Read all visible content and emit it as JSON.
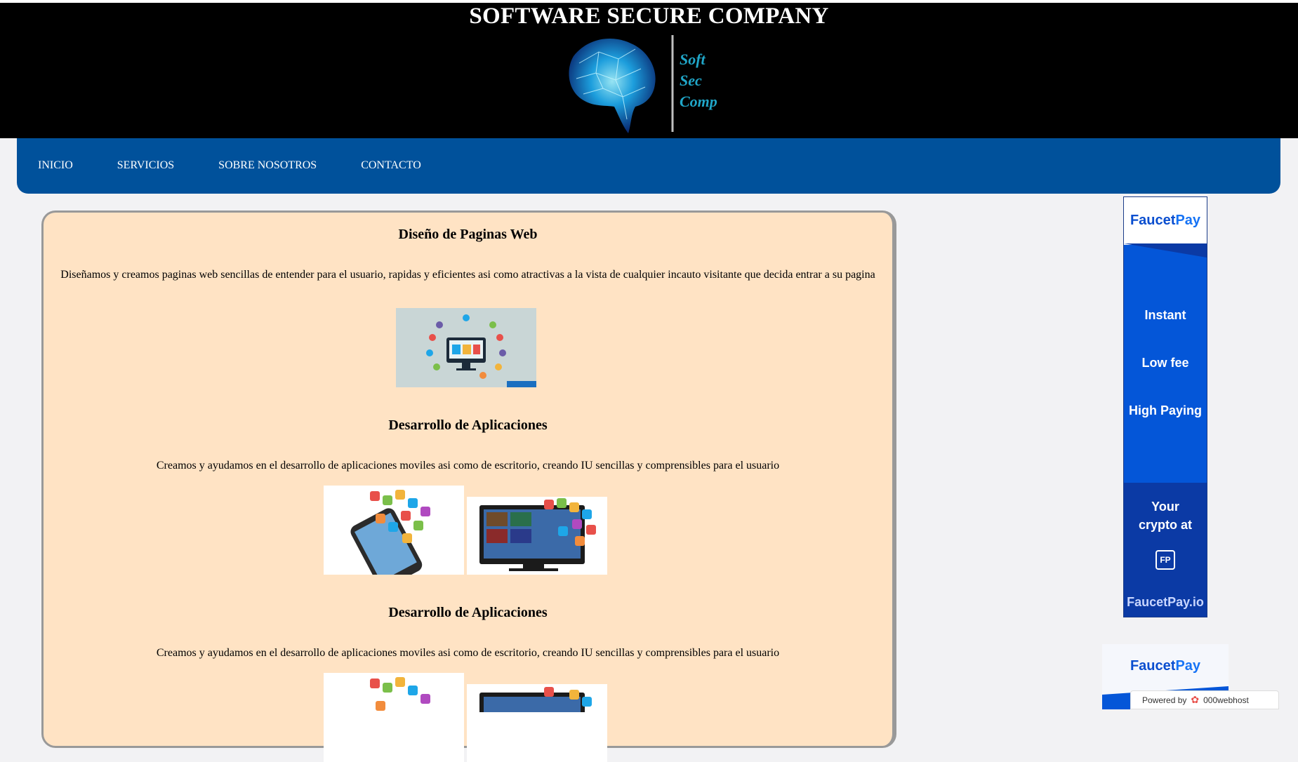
{
  "header": {
    "title": "SOFTWARE SECURE COMPANY",
    "logo_text": [
      "Soft",
      "Sec",
      "Comp"
    ]
  },
  "nav": {
    "items": [
      "INICIO",
      "SERVICIOS",
      "SOBRE NOSOTROS",
      "CONTACTO"
    ]
  },
  "sections": [
    {
      "title": "Diseño de Paginas Web",
      "text": "Diseñamos y creamos paginas web sencillas de entender para el usuario, rapidas y eficientes asi como atractivas a la vista de cualquier incauto visitante que decida entrar a su pagina"
    },
    {
      "title": "Desarrollo de Aplicaciones",
      "text": "Creamos y ayudamos en el desarrollo de aplicaciones moviles asi como de escritorio, creando IU sencillas y comprensibles para el usuario"
    },
    {
      "title": "Desarrollo de Aplicaciones",
      "text": "Creamos y ayudamos en el desarrollo de aplicaciones moviles asi como de escritorio, creando IU sencillas y comprensibles para el usuario"
    }
  ],
  "ad": {
    "brand_a": "Faucet",
    "brand_b": "Pay",
    "line1": "Instant",
    "line2": "Low fee",
    "line3": "High Paying",
    "line4": "Your",
    "line5": "crypto at",
    "logo_mark": "FP",
    "domain": "FaucetPay.io"
  },
  "ad2": {
    "brand_a": "Faucet",
    "brand_b": "Pay"
  },
  "powered": {
    "label": "Powered by",
    "brand": "000webhost"
  },
  "colors": {
    "header_bg": "#000000",
    "nav_bg": "#00519b",
    "content_bg": "#ffe3c4",
    "ad_blue": "#0456d8"
  }
}
